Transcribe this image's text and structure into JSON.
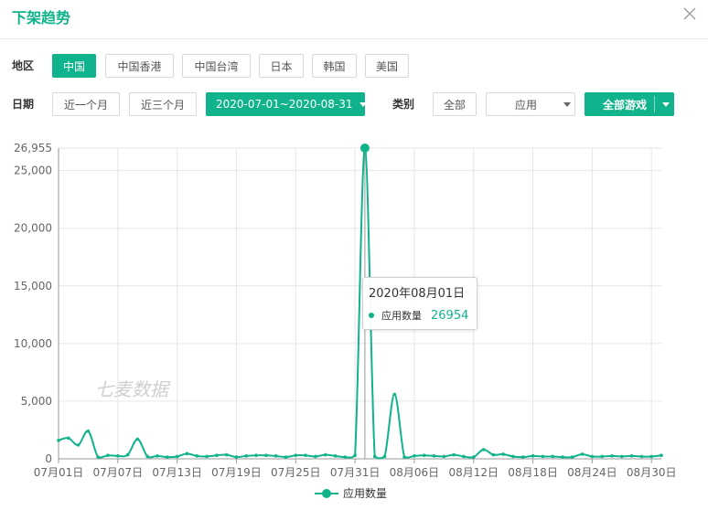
{
  "dialog": {
    "title": "下架趋势"
  },
  "region": {
    "label": "地区",
    "options": [
      "中国",
      "中国香港",
      "中国台湾",
      "日本",
      "韩国",
      "美国"
    ],
    "selected": "中国"
  },
  "date": {
    "label": "日期",
    "quick": [
      "近一个月",
      "近三个月"
    ],
    "range": "2020-07-01~2020-08-31"
  },
  "category": {
    "label": "类别",
    "all": "全部",
    "type_select": "应用",
    "game_select": "全部游戏"
  },
  "watermark": "七麦数据",
  "tooltip": {
    "date": "2020年08月01日",
    "series": "应用数量",
    "value": "26954"
  },
  "colors": {
    "accent": "#10b38c"
  },
  "chart_data": {
    "type": "line",
    "title": "",
    "xlabel": "",
    "ylabel": "",
    "ylim": [
      0,
      26955
    ],
    "yticks": [
      "0",
      "5,000",
      "10,000",
      "15,000",
      "20,000",
      "25,000",
      "26,955"
    ],
    "yticks_values": [
      0,
      5000,
      10000,
      15000,
      20000,
      25000,
      26955
    ],
    "xticks": [
      "07月01日",
      "07月07日",
      "07月13日",
      "07月19日",
      "07月25日",
      "07月31日",
      "08月06日",
      "08月12日",
      "08月18日",
      "08月24日",
      "08月30日"
    ],
    "grid": true,
    "legend": "bottom-center",
    "series": [
      {
        "name": "应用数量",
        "color": "#10b38c",
        "x": [
          "07月01日",
          "07月02日",
          "07月03日",
          "07月04日",
          "07月05日",
          "07月06日",
          "07月07日",
          "07月08日",
          "07月09日",
          "07月10日",
          "07月11日",
          "07月12日",
          "07月13日",
          "07月14日",
          "07月15日",
          "07月16日",
          "07月17日",
          "07月18日",
          "07月19日",
          "07月20日",
          "07月21日",
          "07月22日",
          "07月23日",
          "07月24日",
          "07月25日",
          "07月26日",
          "07月27日",
          "07月28日",
          "07月29日",
          "07月30日",
          "07月31日",
          "08月01日",
          "08月02日",
          "08月03日",
          "08月04日",
          "08月05日",
          "08月06日",
          "08月07日",
          "08月08日",
          "08月09日",
          "08月10日",
          "08月11日",
          "08月12日",
          "08月13日",
          "08月14日",
          "08月15日",
          "08月16日",
          "08月17日",
          "08月18日",
          "08月19日",
          "08月20日",
          "08月21日",
          "08月22日",
          "08月23日",
          "08月24日",
          "08月25日",
          "08月26日",
          "08月27日",
          "08月28日",
          "08月29日",
          "08月30日",
          "08月31日"
        ],
        "values": [
          1600,
          1800,
          1200,
          2400,
          150,
          300,
          250,
          350,
          1700,
          200,
          250,
          150,
          200,
          450,
          250,
          200,
          300,
          350,
          150,
          250,
          300,
          300,
          250,
          150,
          300,
          300,
          200,
          350,
          250,
          150,
          300,
          26954,
          200,
          200,
          5600,
          150,
          250,
          300,
          250,
          200,
          350,
          200,
          150,
          800,
          350,
          400,
          200,
          150,
          250,
          200,
          200,
          150,
          150,
          400,
          200,
          200,
          250,
          200,
          250,
          200,
          200,
          300
        ]
      }
    ]
  }
}
